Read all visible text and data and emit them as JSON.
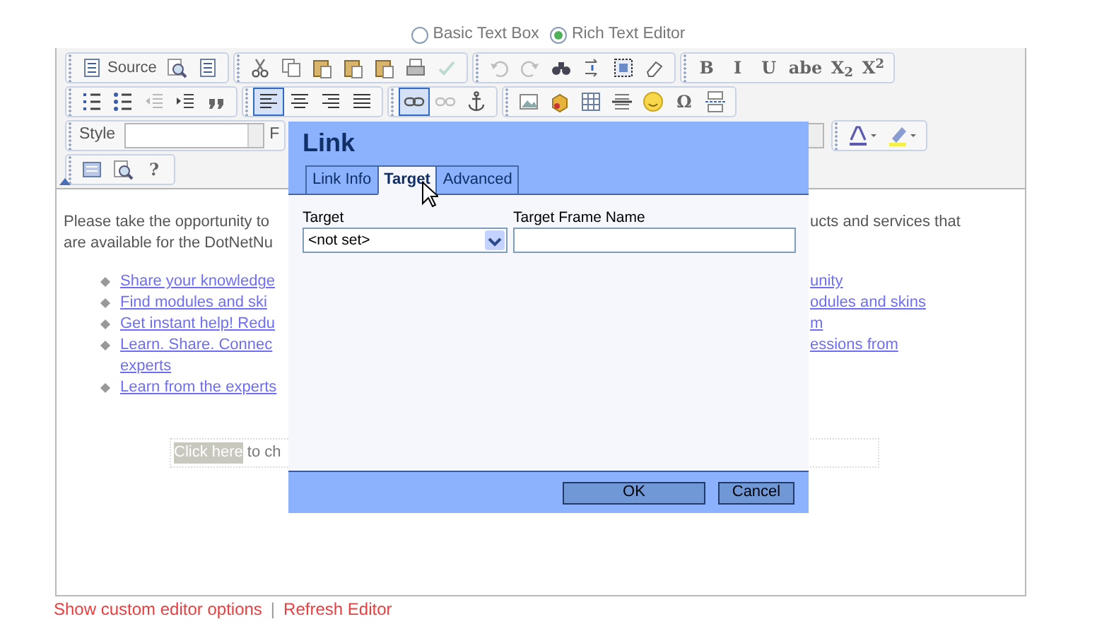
{
  "editor_mode": [
    {
      "label": "Basic Text Box",
      "selected": false
    },
    {
      "label": "Rich Text Editor",
      "selected": true
    }
  ],
  "toolbar": {
    "rows": [
      [
        {
          "buttons": [
            {
              "label": "Source",
              "pressed": false,
              "disabled": false
            },
            {
              "pressed": false,
              "disabled": false
            },
            {
              "pressed": false,
              "disabled": false
            }
          ]
        },
        {
          "buttons": [
            {
              "pressed": false,
              "disabled": false
            },
            {
              "pressed": false,
              "disabled": false
            },
            {
              "pressed": false,
              "disabled": false
            },
            {
              "pressed": false,
              "disabled": false
            },
            {
              "pressed": false,
              "disabled": false
            },
            {
              "pressed": false,
              "disabled": false
            },
            {
              "pressed": false,
              "disabled": true
            }
          ]
        },
        {
          "buttons": [
            {
              "pressed": false,
              "disabled": true
            },
            {
              "pressed": false,
              "disabled": true
            },
            {
              "pressed": false,
              "disabled": false
            },
            {
              "pressed": false,
              "disabled": false
            },
            {
              "pressed": false,
              "disabled": false
            },
            {
              "pressed": false,
              "disabled": false
            }
          ]
        },
        {
          "buttons": [
            {
              "label": "B",
              "pressed": false,
              "disabled": false
            },
            {
              "label": "I",
              "pressed": false,
              "disabled": false
            },
            {
              "label": "U",
              "pressed": false,
              "disabled": false
            },
            {
              "label": "abe",
              "pressed": false,
              "disabled": false
            },
            {
              "label": "X$_{2}$",
              "pressed": false,
              "disabled": false
            },
            {
              "label": "X$^{2}$",
              "pressed": false,
              "disabled": false
            }
          ]
        }
      ],
      [
        {
          "buttons": [
            {
              "pressed": false,
              "disabled": false
            },
            {
              "pressed": false,
              "disabled": false
            },
            {
              "pressed": false,
              "disabled": true
            },
            {
              "pressed": false,
              "disabled": false
            },
            {
              "pressed": false,
              "disabled": false
            }
          ]
        },
        {
          "buttons": [
            {
              "pressed": true,
              "disabled": false
            },
            {
              "pressed": false,
              "disabled": false
            },
            {
              "pressed": false,
              "disabled": false
            },
            {
              "pressed": false,
              "disabled": false
            }
          ]
        },
        {
          "buttons": [
            {
              "pressed": true,
              "disabled": false
            },
            {
              "pressed": false,
              "disabled": true
            },
            {
              "pressed": false,
              "disabled": false
            }
          ]
        },
        {
          "buttons": [
            {
              "pressed": false,
              "disabled": false
            },
            {
              "pressed": false,
              "disabled": false
            },
            {
              "pressed": false,
              "disabled": false
            },
            {
              "pressed": false,
              "disabled": false
            },
            {
              "pressed": false,
              "disabled": false
            },
            {
              "label": "Ω",
              "pressed": false,
              "disabled": false
            },
            {
              "pressed": false,
              "disabled": false
            }
          ]
        }
      ],
      [],
      [
        {
          "buttons": [
            {
              "pressed": false,
              "disabled": false
            },
            {
              "pressed": false,
              "disabled": false
            },
            {
              "label": "?",
              "pressed": false,
              "disabled": false
            }
          ]
        }
      ]
    ],
    "style_label": "Style",
    "format_label": "F"
  },
  "content": {
    "paragraph_lines": [
      {
        "left": "Please take the opportunity to",
        "right": "ucts and services that"
      },
      {
        "left": "are available for the DotNetNu"
      }
    ],
    "list_lines": [
      {
        "bullet": true,
        "left": "Share your knowledge",
        "right": "unity"
      },
      {
        "bullet": true,
        "left": "Find modules and ski",
        "right": "odules and skins"
      },
      {
        "bullet": true,
        "left": "Get instant help! Redu",
        "right": "m"
      },
      {
        "bullet": true,
        "left": "Learn. Share. Connec",
        "right": "essions from"
      },
      {
        "bullet": false,
        "left": "experts"
      },
      {
        "bullet": true,
        "left": "Learn from the experts"
      }
    ],
    "banner": {
      "highlight": "Click here",
      "text": "to ch"
    }
  },
  "dialog": {
    "title": "Link",
    "tabs": [
      {
        "label": "Link Info",
        "selected": false
      },
      {
        "label": "Target",
        "selected": true
      },
      {
        "label": "Advanced",
        "selected": false
      }
    ],
    "fields": [
      {
        "kind": "select",
        "label": "Target",
        "value": "<not set>"
      },
      {
        "kind": "text",
        "label": "Target Frame Name"
      }
    ],
    "buttons": [
      {
        "label": "OK"
      },
      {
        "label": "Cancel"
      }
    ]
  },
  "footer": {
    "links": [
      "Show custom editor options",
      "Refresh Editor"
    ],
    "separator": "|"
  }
}
